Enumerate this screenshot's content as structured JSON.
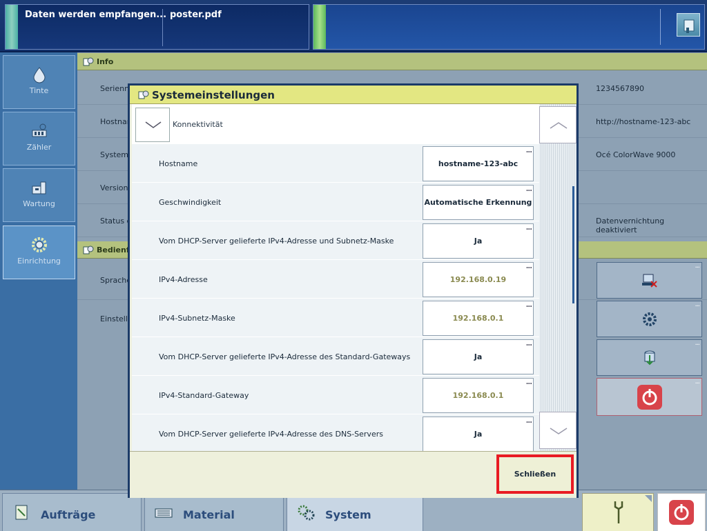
{
  "topbar": {
    "status_text": "Daten werden empfangen...",
    "file_name": "poster.pdf"
  },
  "nav": {
    "items": [
      {
        "label": "Tinte",
        "icon": "ink-drop-icon"
      },
      {
        "label": "Zähler",
        "icon": "counter-icon"
      },
      {
        "label": "Wartung",
        "icon": "maintenance-icon"
      },
      {
        "label": "Einrichtung",
        "icon": "settings-gear-icon"
      }
    ]
  },
  "info": {
    "header": "Info",
    "rows": [
      {
        "label": "Seriennu",
        "value": "1234567890"
      },
      {
        "label": "Hostnam",
        "value": "http://hostname-123-abc"
      },
      {
        "label": "System",
        "value": "Océ ColorWave 9000"
      },
      {
        "label": "Version d",
        "value": ""
      },
      {
        "label": "Status d",
        "value": "Datenvernichtung deaktiviert"
      }
    ]
  },
  "operator": {
    "header": "Bedienfe",
    "rows": [
      {
        "label": "Sprache"
      },
      {
        "label": "Einstellu"
      }
    ]
  },
  "dialog": {
    "title": "Systemeinstellungen",
    "group_label": "Konnektivität",
    "close_label": "Schließen",
    "rows": [
      {
        "label": "Hostname",
        "value": "hostname-123-abc",
        "editable": true
      },
      {
        "label": "Geschwindigkeit",
        "value": "Automatische Erkennung",
        "editable": true
      },
      {
        "label": "Vom DHCP-Server gelieferte IPv4-Adresse und Subnetz-Maske",
        "value": "Ja",
        "editable": true
      },
      {
        "label": "IPv4-Adresse",
        "value": "192.168.0.19",
        "editable": false
      },
      {
        "label": "IPv4-Subnetz-Maske",
        "value": "192.168.0.1",
        "editable": false
      },
      {
        "label": "Vom DHCP-Server gelieferte IPv4-Adresse des Standard-Gateways",
        "value": "Ja",
        "editable": true
      },
      {
        "label": "IPv4-Standard-Gateway",
        "value": "192.168.0.1",
        "editable": false
      },
      {
        "label": "Vom DHCP-Server gelieferte IPv4-Adresse des DNS-Servers",
        "value": "Ja",
        "editable": true
      }
    ],
    "dots": "..."
  },
  "bottom": {
    "tabs": [
      {
        "label": "Aufträge"
      },
      {
        "label": "Material"
      },
      {
        "label": "System"
      }
    ]
  },
  "colors": {
    "accent_header": "#b4c27e",
    "dialog_title": "#e3e782",
    "highlight_red": "#e81b23",
    "nav_blue": "#3a6ea4"
  }
}
